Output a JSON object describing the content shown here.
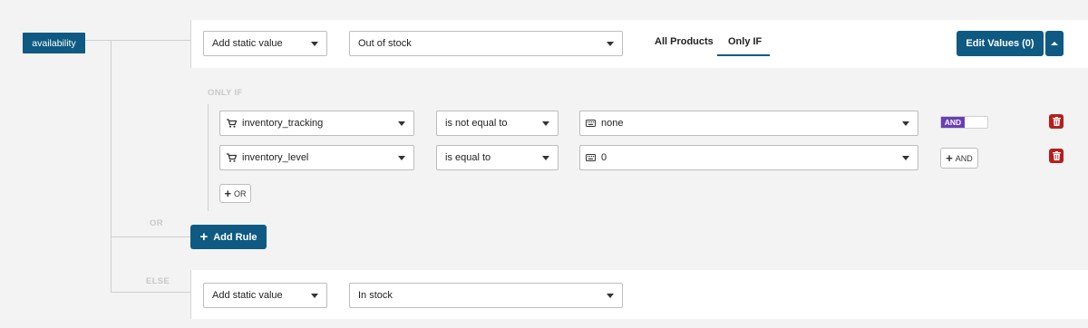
{
  "field": {
    "label": "availability"
  },
  "top_rule": {
    "source_select": "Add static value",
    "value_select": "Out of stock",
    "tabs": [
      "All Products",
      "Only IF"
    ],
    "active_tab": "Only IF",
    "edit_button": "Edit Values (0)"
  },
  "only_if": {
    "label": "ONLY IF",
    "conditions": [
      {
        "attribute": "inventory_tracking",
        "operator": "is not equal to",
        "value": "none",
        "connector": "AND"
      },
      {
        "attribute": "inventory_level",
        "operator": "is equal to",
        "value": "0",
        "connector": "AND"
      }
    ],
    "or_button": "OR"
  },
  "or_label": "OR",
  "add_rule_button": "Add Rule",
  "else_rule": {
    "label": "ELSE",
    "source_select": "Add static value",
    "value_select": "In stock"
  },
  "colors": {
    "primary": "#0f5a82",
    "and_toggle": "#6a3fb5",
    "delete": "#b51f1f"
  }
}
